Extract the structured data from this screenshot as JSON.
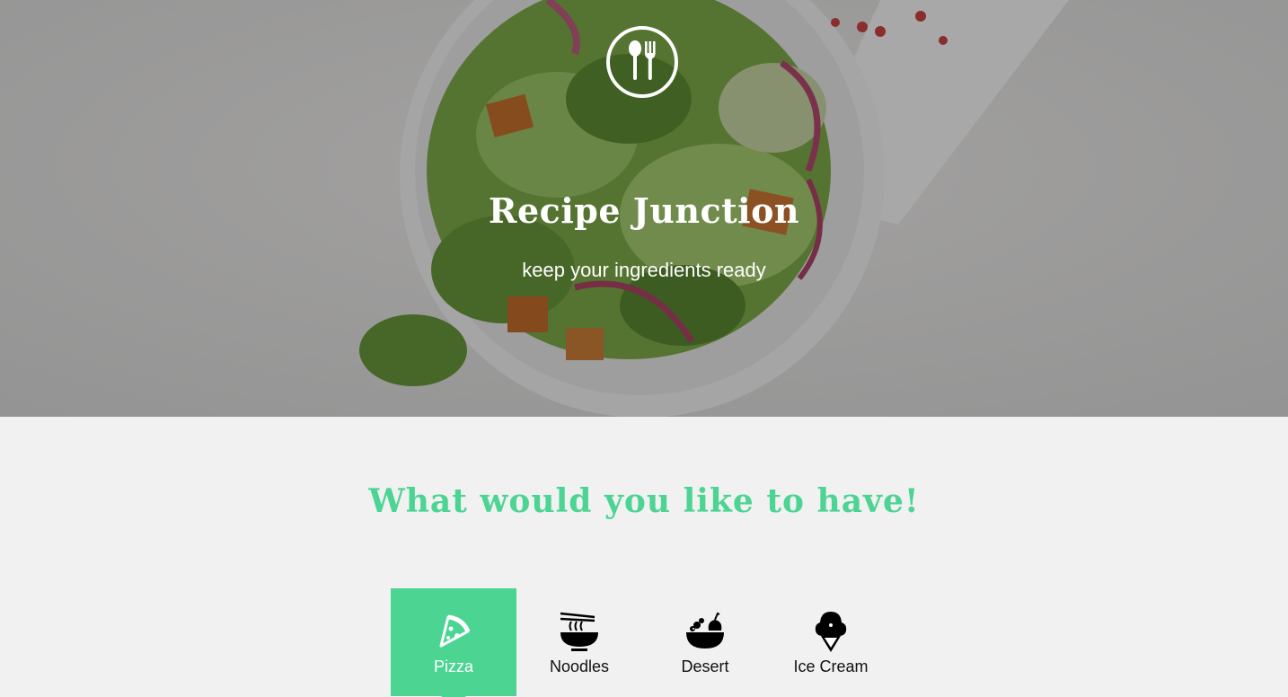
{
  "hero": {
    "title": "Recipe Junction",
    "subtitle": "keep your ingredients ready",
    "logo_icon": "spoon-fork-icon"
  },
  "section": {
    "title": "What would you like to have!"
  },
  "categories": [
    {
      "label": "Pizza",
      "icon": "pizza-icon",
      "active": true
    },
    {
      "label": "Noodles",
      "icon": "noodles-icon",
      "active": false
    },
    {
      "label": "Desert",
      "icon": "dessert-bowl-icon",
      "active": false
    },
    {
      "label": "Ice Cream",
      "icon": "ice-cream-icon",
      "active": false
    }
  ],
  "colors": {
    "accent": "#4cd493",
    "page_background": "#f1f1f1",
    "hero_text": "#ffffff"
  }
}
